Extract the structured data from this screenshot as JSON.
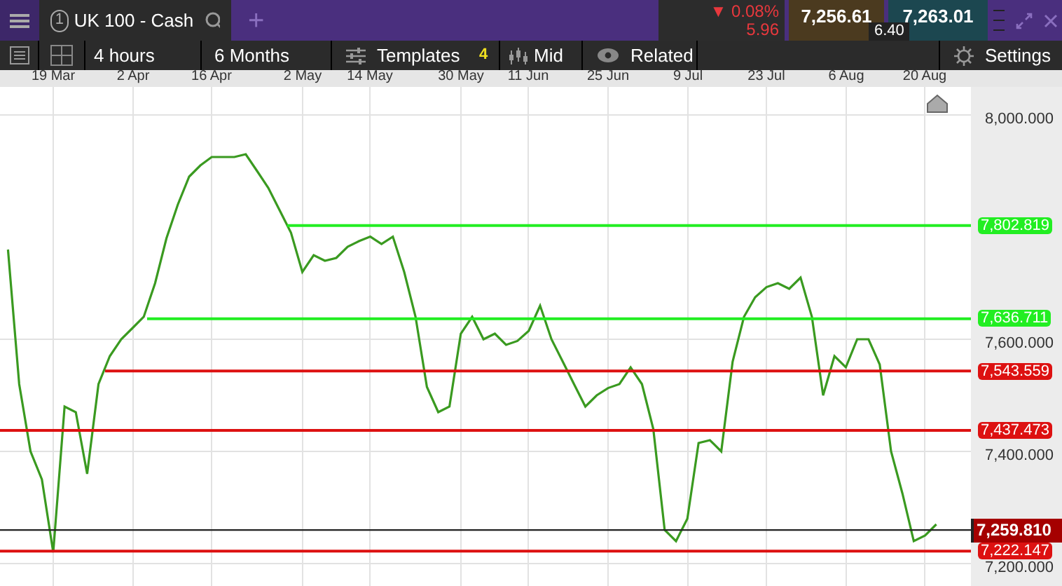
{
  "top_bar": {
    "tab": {
      "number": "1",
      "name": "UK 100 - Cash",
      "selected": true
    },
    "add_tab": "+",
    "change_percent": "▼ 0.08%",
    "change_points": "5.96",
    "sell": "7,256.61",
    "buy": "7,263.01",
    "spread": "6.40"
  },
  "toolbar": {
    "interval": "4 hours",
    "range": "6 Months",
    "templates": "Templates",
    "templates_count": "4",
    "price_type": "Mid",
    "related": "Related",
    "settings": "Settings"
  },
  "chart": {
    "chart_data": {
      "type": "line",
      "ylim": [
        7160,
        8050
      ],
      "grid": true,
      "categories": [
        null,
        null,
        null,
        null,
        "19 Mar",
        null,
        null,
        null,
        null,
        null,
        null,
        "2 Apr",
        null,
        null,
        null,
        null,
        null,
        null,
        "16 Apr",
        null,
        null,
        null,
        null,
        null,
        null,
        null,
        "2 May",
        null,
        null,
        null,
        null,
        null,
        "14 May",
        null,
        null,
        null,
        null,
        null,
        null,
        null,
        "30 May",
        null,
        null,
        null,
        null,
        null,
        "11 Jun",
        null,
        null,
        null,
        null,
        null,
        null,
        "25 Jun",
        null,
        null,
        null,
        null,
        null,
        null,
        "9 Jul",
        null,
        null,
        null,
        null,
        null,
        null,
        "23 Jul",
        null,
        null,
        null,
        null,
        null,
        null,
        "6 Aug",
        null,
        null,
        null,
        null,
        null,
        null,
        "20 Aug",
        null
      ],
      "series": [
        {
          "color": "#3a9a20",
          "values": [
            7760,
            7520,
            7400,
            7350,
            7220,
            7480,
            7470,
            7360,
            7520,
            7570,
            7600,
            7620,
            7640,
            7700,
            7780,
            7840,
            7890,
            7910,
            7925,
            7925,
            7925,
            7930,
            7900,
            7870,
            7830,
            7790,
            7720,
            7750,
            7740,
            7745,
            7765,
            7775,
            7783,
            7770,
            7783,
            7720,
            7640,
            7515,
            7470,
            7480,
            7610,
            7640,
            7600,
            7610,
            7590,
            7597,
            7615,
            7660,
            7600,
            7560,
            7520,
            7480,
            7500,
            7513,
            7520,
            7550,
            7520,
            7440,
            7260,
            7240,
            7280,
            7415,
            7420,
            7400,
            7560,
            7640,
            7675,
            7693,
            7700,
            7690,
            7710,
            7640,
            7500,
            7570,
            7550,
            7600,
            7600,
            7555,
            7400,
            7325,
            7240,
            7250,
            7270
          ]
        }
      ],
      "yticks": [
        {
          "value": 8000,
          "label": "8,000.000"
        },
        {
          "value": 7600,
          "label": "7,600.000"
        },
        {
          "value": 7400,
          "label": "7,400.000"
        },
        {
          "value": 7200,
          "label": "7,200.000"
        }
      ]
    },
    "levels": [
      {
        "kind": "line",
        "label": "7,802.819",
        "color": "#22ee22"
      },
      {
        "kind": "line",
        "label": "7,636.711",
        "color": "#22ee22"
      },
      {
        "kind": "line",
        "label": "7,543.559",
        "color": "#dd1111"
      },
      {
        "kind": "line",
        "label": "7,437.473",
        "color": "#dd1111"
      },
      {
        "kind": "current",
        "label": "7,259.810",
        "color": "#222222"
      },
      {
        "kind": "line",
        "label": "7,222.147",
        "color": "#dd1111"
      }
    ]
  }
}
